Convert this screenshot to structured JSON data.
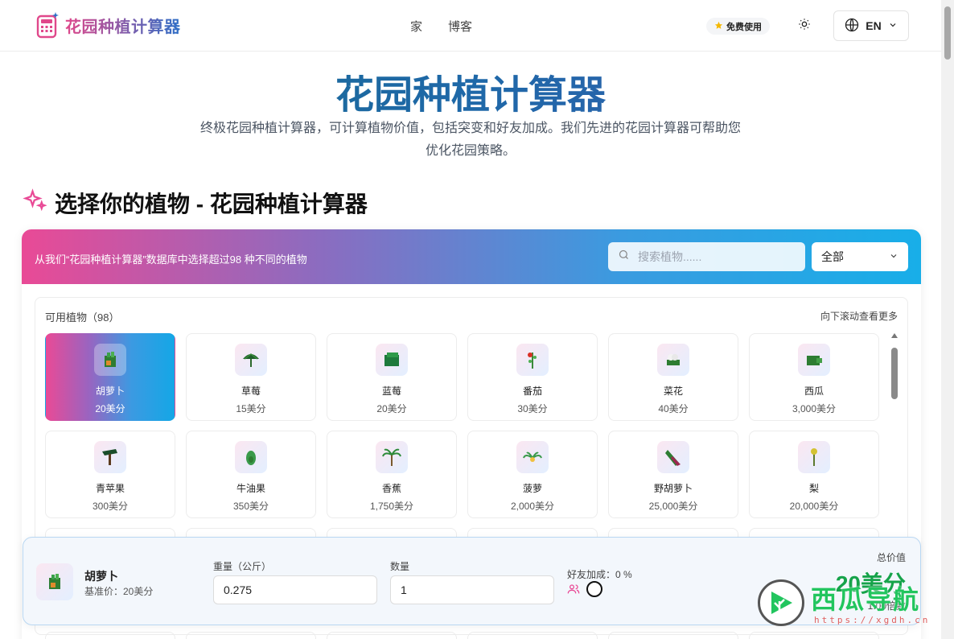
{
  "header": {
    "logo_text": "花园种植计算器",
    "nav": [
      "家",
      "博客"
    ],
    "free_badge": "免费使用",
    "lang": "EN"
  },
  "hero": {
    "title": "花园种植计算器",
    "description": "终极花园种植计算器，可计算植物价值，包括突变和好友加成。我们先进的花园计算器可帮助您优化花园策略。"
  },
  "section": {
    "title": "选择你的植物 - 花园种植计算器"
  },
  "panel": {
    "banner_text": "从我们“花园种植计算器”数据库中选择超过98 种不同的植物",
    "search_placeholder": "搜索植物......",
    "filter_value": "全部",
    "count_label": "可用植物（98）",
    "scroll_hint": "向下滚动查看更多"
  },
  "plants": [
    {
      "name": "胡萝卜",
      "price": "20美分",
      "icon": "carrot-icon",
      "selected": true
    },
    {
      "name": "草莓",
      "price": "15美分",
      "icon": "strawberry-icon"
    },
    {
      "name": "蓝莓",
      "price": "20美分",
      "icon": "blueberry-icon"
    },
    {
      "name": "番茄",
      "price": "30美分",
      "icon": "tomato-icon"
    },
    {
      "name": "菜花",
      "price": "40美分",
      "icon": "cauliflower-icon"
    },
    {
      "name": "西瓜",
      "price": "3,000美分",
      "icon": "watermelon-icon"
    },
    {
      "name": "青苹果",
      "price": "300美分",
      "icon": "green-apple-icon"
    },
    {
      "name": "牛油果",
      "price": "350美分",
      "icon": "avocado-icon"
    },
    {
      "name": "香蕉",
      "price": "1,750美分",
      "icon": "banana-icon"
    },
    {
      "name": "菠萝",
      "price": "2,000美分",
      "icon": "pineapple-icon"
    },
    {
      "name": "野胡萝卜",
      "price": "25,000美分",
      "icon": "wild-carrot-icon"
    },
    {
      "name": "梨",
      "price": "20,000美分",
      "icon": "pear-icon"
    }
  ],
  "calculator": {
    "plant_name": "胡萝卜",
    "base_price": "基准价：20美分",
    "weight_label": "重量（公斤）",
    "weight_value": "0.275",
    "quantity_label": "数量",
    "quantity_value": "1",
    "friend_bonus_label": "好友加成：0 %",
    "total_label": "总价值",
    "total_value": "20美分",
    "total_sub": "1.00倍数"
  },
  "watermark": {
    "text": "西瓜导航",
    "url": "https://xgdh.cn"
  },
  "colors": {
    "accent_pink": "#e94a96",
    "accent_blue": "#18aee8",
    "total_green": "#16a34a"
  }
}
